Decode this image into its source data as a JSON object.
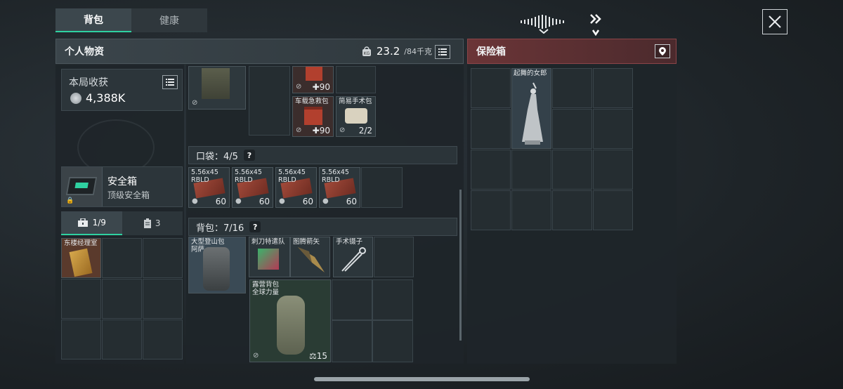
{
  "tabs": [
    {
      "label": "背包"
    },
    {
      "label": "健康"
    }
  ],
  "personal": {
    "title": "个人物资",
    "weight_current": "23.2",
    "weight_max": "/84千克"
  },
  "safe": {
    "title": "保险箱"
  },
  "earnings": {
    "title": "本局收获",
    "value": "4,388K"
  },
  "safebox": {
    "name": "安全箱",
    "sub": "顶级安全箱"
  },
  "side_tabs": {
    "a": "1/9",
    "b": "3"
  },
  "keycard": {
    "label": "东楼经理室"
  },
  "gear": {
    "med1": {
      "count": "90"
    },
    "med2": {
      "label": "车载急救包",
      "count": "90"
    },
    "med3": {
      "label": "简易手术包",
      "count": "2/2"
    }
  },
  "pocket": {
    "label": "口袋：",
    "count": "4/5",
    "help": "?",
    "items": [
      {
        "label": "5.56x45\nRBLD",
        "count": "60"
      },
      {
        "label": "5.56x45\nRBLD",
        "count": "60"
      },
      {
        "label": "5.56x45\nRBLD",
        "count": "60"
      },
      {
        "label": "5.56x45\nRBLD",
        "count": "60"
      }
    ]
  },
  "backpack": {
    "label": "背包：",
    "count": "7/16",
    "help": "?",
    "items": [
      {
        "label": "大型登山包\n阿萨"
      },
      {
        "label": "刺刀特遣队"
      },
      {
        "label": "图腾箭矢"
      },
      {
        "label": "手术镊子"
      },
      {
        "label": "露营背包\n全球力量",
        "count": "15"
      }
    ]
  },
  "vault_item": {
    "label": "起舞的女郎"
  },
  "colors": {
    "accent": "#2fd1a1",
    "danger": "#8a4448"
  }
}
